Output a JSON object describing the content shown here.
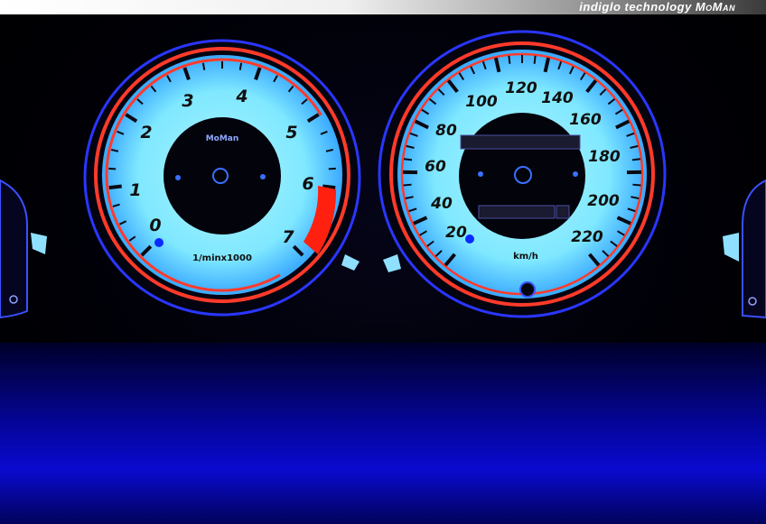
{
  "banner": {
    "text": "indiglo technology",
    "brand": "MoMan"
  },
  "tachometer": {
    "logo": "MoMan",
    "unit_label": "1/minx1000",
    "numbers": [
      "0",
      "1",
      "2",
      "3",
      "4",
      "5",
      "6",
      "7"
    ],
    "redline_color": "#ff2010",
    "face_color": "#7fe8ff",
    "ring_color": "#ff3a2a"
  },
  "speedometer": {
    "unit_label": "km/h",
    "numbers": [
      "20",
      "40",
      "60",
      "80",
      "100",
      "120",
      "140",
      "160",
      "180",
      "200",
      "220"
    ],
    "face_color": "#7fe8ff",
    "ring_color": "#ff3a2a"
  },
  "reflection_color": "#1a1aff"
}
